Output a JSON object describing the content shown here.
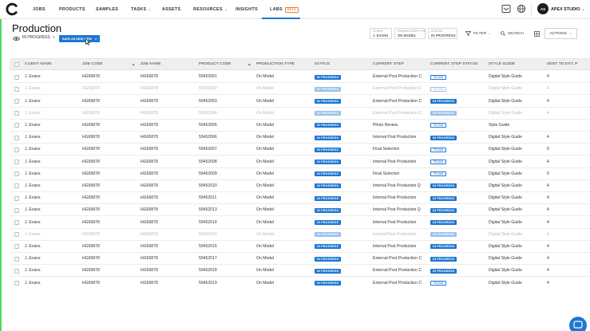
{
  "nav": {
    "items": [
      {
        "label": "JOBS",
        "chevron": false
      },
      {
        "label": "PRODUCTS",
        "chevron": false
      },
      {
        "label": "SAMPLES",
        "chevron": false
      },
      {
        "label": "TASKS",
        "chevron": true
      },
      {
        "label": "ASSETS",
        "chevron": false
      },
      {
        "label": "RESOURCES",
        "chevron": true
      },
      {
        "label": "INSIGHTS",
        "chevron": false
      },
      {
        "label": "LABS",
        "chevron": false,
        "badge": "BETA",
        "active": true
      }
    ],
    "studio_name": "APEX STUDIO",
    "avatar_initials": "AS",
    "icons": [
      "brand-logo-icon",
      "inbox-icon",
      "globe-icon",
      "chevron-down-icon"
    ]
  },
  "page": {
    "title": "Production",
    "view_label": "IN PROGRESS",
    "save_view_label": "SAVE AS NEW VIEW"
  },
  "filters": {
    "chips": [
      {
        "key": "CLIENT",
        "value": "J. EVANS"
      },
      {
        "key": "PRODUCTION TYPE",
        "value": "ON MODEL"
      },
      {
        "key": "STATUS",
        "value": "IN PROGRESS"
      }
    ],
    "filter_label": "FILTER",
    "search_label": "SEARCH",
    "actions_label": "ACTIONS"
  },
  "table": {
    "columns": [
      {
        "label": "CLIENT NAME",
        "sort": null
      },
      {
        "label": "JOB CODE",
        "sort": "desc"
      },
      {
        "label": "JOB NAME",
        "sort": null
      },
      {
        "label": "PRODUCT CODE",
        "sort": "asc"
      },
      {
        "label": "PRODUCTION TYPE",
        "sort": null
      },
      {
        "label": "STATUS",
        "sort": null
      },
      {
        "label": "CURRENT STEP",
        "sort": null
      },
      {
        "label": "CURRENT STEP STATUS",
        "sort": null
      },
      {
        "label": "STYLE GUIDE",
        "sort": null
      },
      {
        "label": "SENT TO EXT. P",
        "sort": null
      }
    ],
    "rows": [
      {
        "client": "J. Evans",
        "job_code": "HG65878",
        "job_name": "HG65878",
        "product_code": "55452001",
        "production_type": "On Model",
        "status": "IN PROGRESS",
        "current_step": "External Post Production C",
        "step_status": "TO DO",
        "style_guide": "Digital Style Guide",
        "sent": "4",
        "dim": false
      },
      {
        "client": "J. Evans",
        "job_code": "HG65878",
        "job_name": "HG65878",
        "product_code": "55452002",
        "production_type": "On Model",
        "status": "IN PROGRESS",
        "current_step": "External Post Production C",
        "step_status": "TO DO",
        "style_guide": "Digital Style Guide",
        "sent": "4",
        "dim": true
      },
      {
        "client": "J. Evans",
        "job_code": "HG65878",
        "job_name": "HG65878",
        "product_code": "55452003",
        "production_type": "On Model",
        "status": "IN PROGRESS",
        "current_step": "External Post Production C",
        "step_status": "IN PROGRESS",
        "style_guide": "Digital Style Guide",
        "sent": "4",
        "dim": false
      },
      {
        "client": "J. Evans",
        "job_code": "HG65878",
        "job_name": "HG65878",
        "product_code": "55452004",
        "production_type": "On Model",
        "status": "IN PROGRESS",
        "current_step": "External Post Production C",
        "step_status": "IN PROGRESS",
        "style_guide": "Digital Style Guide",
        "sent": "4",
        "dim": true
      },
      {
        "client": "J. Evans",
        "job_code": "HG65878",
        "job_name": "HG65878",
        "product_code": "55452005",
        "production_type": "On Model",
        "status": "IN PROGRESS",
        "current_step": "Photo Review",
        "step_status": "TO DO",
        "style_guide": "Style Guide",
        "sent": "",
        "dim": false
      },
      {
        "client": "J. Evans",
        "job_code": "HG65878",
        "job_name": "HG65878",
        "product_code": "55452006",
        "production_type": "On Model",
        "status": "IN PROGRESS",
        "current_step": "Internal Post Production",
        "step_status": "IN PROGRESS",
        "style_guide": "Digital Style Guide",
        "sent": "4",
        "dim": false
      },
      {
        "client": "J. Evans",
        "job_code": "HG65878",
        "job_name": "HG65878",
        "product_code": "55452007",
        "production_type": "On Model",
        "status": "IN PROGRESS",
        "current_step": "Final Selection",
        "step_status": "TO DO",
        "style_guide": "Digital Style Guide",
        "sent": "0",
        "dim": false
      },
      {
        "client": "J. Evans",
        "job_code": "HG65878",
        "job_name": "HG65878",
        "product_code": "55452008",
        "production_type": "On Model",
        "status": "IN PROGRESS",
        "current_step": "Internal Post Production",
        "step_status": "TO DO",
        "style_guide": "Digital Style Guide",
        "sent": "4",
        "dim": false
      },
      {
        "client": "J. Evans",
        "job_code": "HG65878",
        "job_name": "HG65878",
        "product_code": "55452009",
        "production_type": "On Model",
        "status": "IN PROGRESS",
        "current_step": "Final Selection",
        "step_status": "TO DO",
        "style_guide": "Digital Style Guide",
        "sent": "0",
        "dim": false
      },
      {
        "client": "J. Evans",
        "job_code": "HG65878",
        "job_name": "HG65878",
        "product_code": "55452010",
        "production_type": "On Model",
        "status": "IN PROGRESS",
        "current_step": "Internal Post Production Q",
        "step_status": "IN PROGRESS",
        "style_guide": "Digital Style Guide",
        "sent": "4",
        "dim": false
      },
      {
        "client": "J. Evans",
        "job_code": "HG65878",
        "job_name": "HG65878",
        "product_code": "55452011",
        "production_type": "On Model",
        "status": "IN PROGRESS",
        "current_step": "Internal Post Production",
        "step_status": "IN PROGRESS",
        "style_guide": "Digital Style Guide",
        "sent": "4",
        "dim": false
      },
      {
        "client": "J. Evans",
        "job_code": "HG65878",
        "job_name": "HG65878",
        "product_code": "55452013",
        "production_type": "On Model",
        "status": "IN PROGRESS",
        "current_step": "Internal Post Production Q",
        "step_status": "IN PROGRESS",
        "style_guide": "Digital Style Guide",
        "sent": "4",
        "dim": false
      },
      {
        "client": "J. Evans",
        "job_code": "HG65878",
        "job_name": "HG65878",
        "product_code": "55452014",
        "production_type": "On Model",
        "status": "IN PROGRESS",
        "current_step": "Internal Post Production",
        "step_status": "IN PROGRESS",
        "style_guide": "Digital Style Guide",
        "sent": "4",
        "dim": false
      },
      {
        "client": "J. Evans",
        "job_code": "HG65878",
        "job_name": "HG65878",
        "product_code": "55452015",
        "production_type": "On Model",
        "status": "IN PROGRESS",
        "current_step": "Internal Post Production",
        "step_status": "IN PROGRESS",
        "style_guide": "Digital Style Guide",
        "sent": "4",
        "dim": true
      },
      {
        "client": "J. Evans",
        "job_code": "HG65878",
        "job_name": "HG65878",
        "product_code": "55452016",
        "production_type": "On Model",
        "status": "IN PROGRESS",
        "current_step": "Internal Post Production",
        "step_status": "IN PROGRESS",
        "style_guide": "Digital Style Guide",
        "sent": "4",
        "dim": false
      },
      {
        "client": "J. Evans",
        "job_code": "HG65878",
        "job_name": "HG65878",
        "product_code": "55452017",
        "production_type": "On Model",
        "status": "IN PROGRESS",
        "current_step": "External Post Production C",
        "step_status": "IN PROGRESS",
        "style_guide": "Digital Style Guide",
        "sent": "4",
        "dim": false
      },
      {
        "client": "J. Evans",
        "job_code": "HG65878",
        "job_name": "HG65878",
        "product_code": "55452018",
        "production_type": "On Model",
        "status": "IN PROGRESS",
        "current_step": "External Post Production C",
        "step_status": "IN PROGRESS",
        "style_guide": "Digital Style Guide",
        "sent": "4",
        "dim": false
      },
      {
        "client": "J. Evans",
        "job_code": "HG65878",
        "job_name": "HG65878",
        "product_code": "55452019",
        "production_type": "On Model",
        "status": "IN PROGRESS",
        "current_step": "External Post Production C",
        "step_status": "TO DO",
        "style_guide": "Digital Style Guide",
        "sent": "4",
        "dim": false
      }
    ]
  },
  "colors": {
    "accent": "#1f78d1",
    "beta": "#f07f2e",
    "edge": "#4cd964",
    "header_bg": "#efefef"
  }
}
